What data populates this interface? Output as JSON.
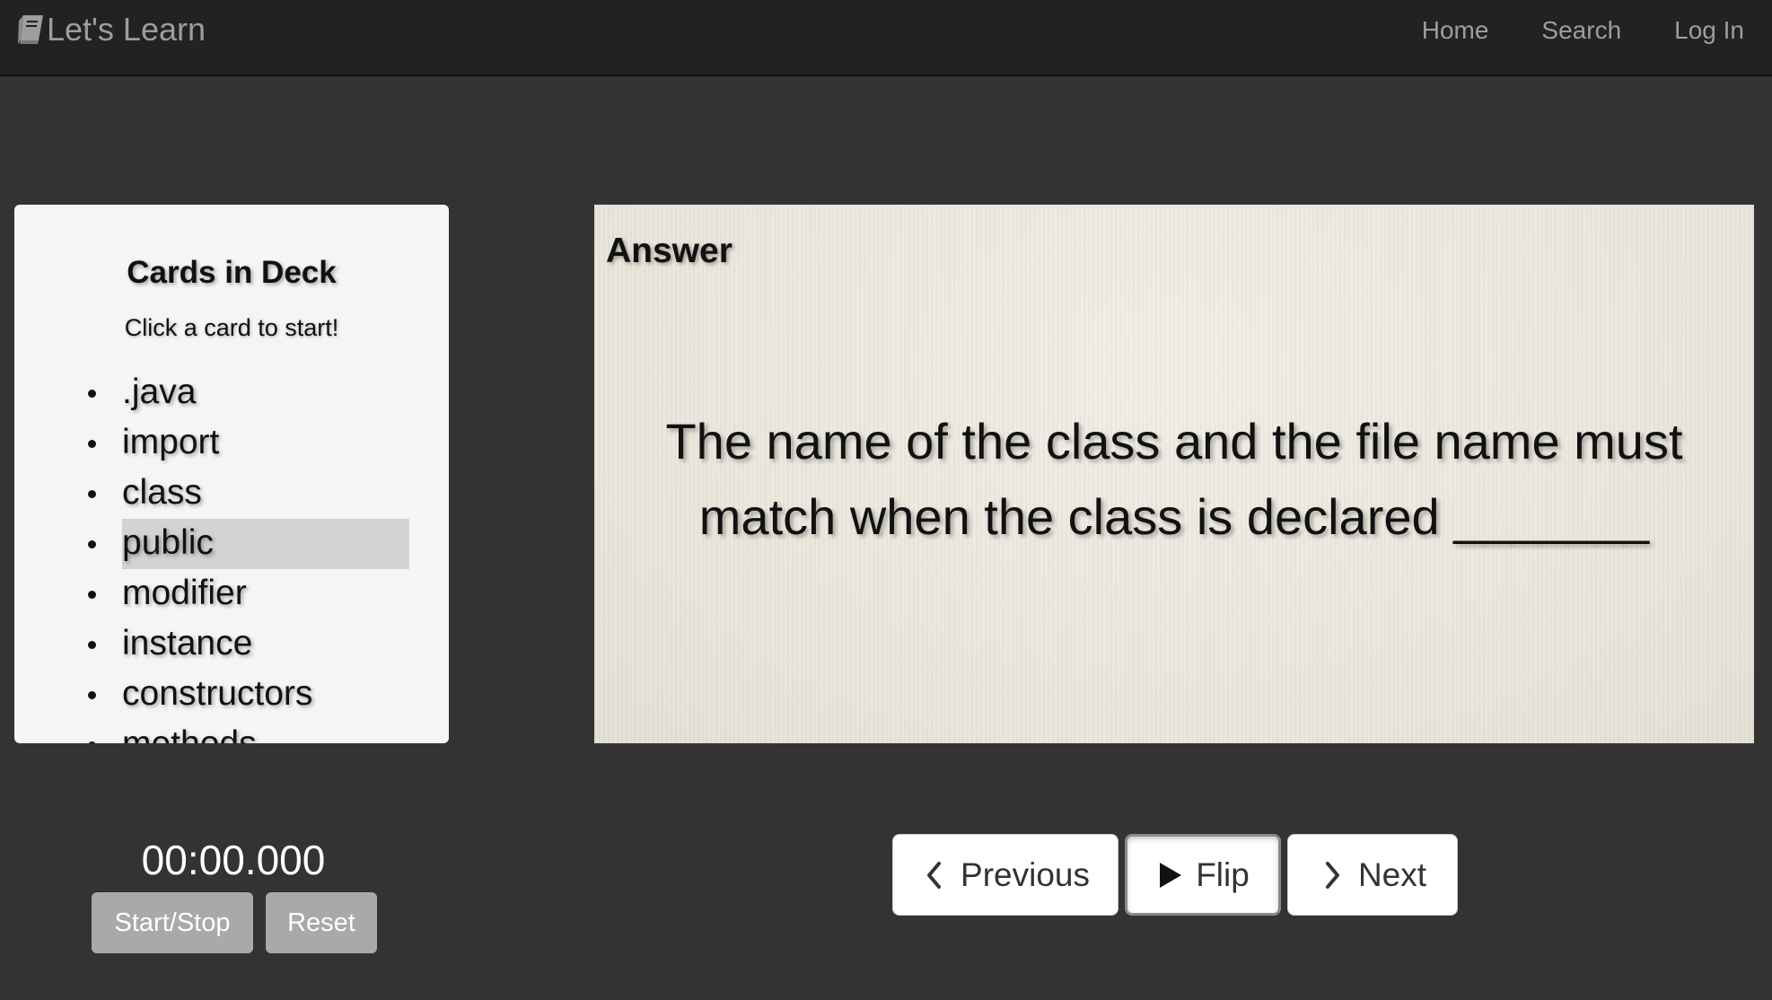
{
  "navbar": {
    "brand": "Let's Learn",
    "brand_icon": "book-icon",
    "links": [
      "Home",
      "Search",
      "Log In"
    ]
  },
  "deck": {
    "title": "Cards in Deck",
    "subtitle": "Click a card to start!",
    "cards": [
      ".java",
      "import",
      "class",
      "public",
      "modifier",
      "instance",
      "constructors",
      "methods"
    ],
    "selected": "public"
  },
  "card": {
    "side": "Answer",
    "text": "The name of the class and the file name must match when the class is declared _______"
  },
  "timer": {
    "display": "00:00.000",
    "start_stop_label": "Start/Stop",
    "reset_label": "Reset"
  },
  "controls": {
    "previous_label": "Previous",
    "flip_label": "Flip",
    "next_label": "Next",
    "previous_icon": "chevron-left-icon",
    "flip_icon": "play-icon",
    "next_icon": "chevron-right-icon"
  },
  "colors": {
    "background": "#333333",
    "navbar": "#222222",
    "nav_text": "#9d9d9d",
    "panel": "#f5f5f5",
    "selected_item": "#d3d3d3",
    "card_paper": "#ebe7de",
    "timer_button": "#a9a9a9"
  }
}
